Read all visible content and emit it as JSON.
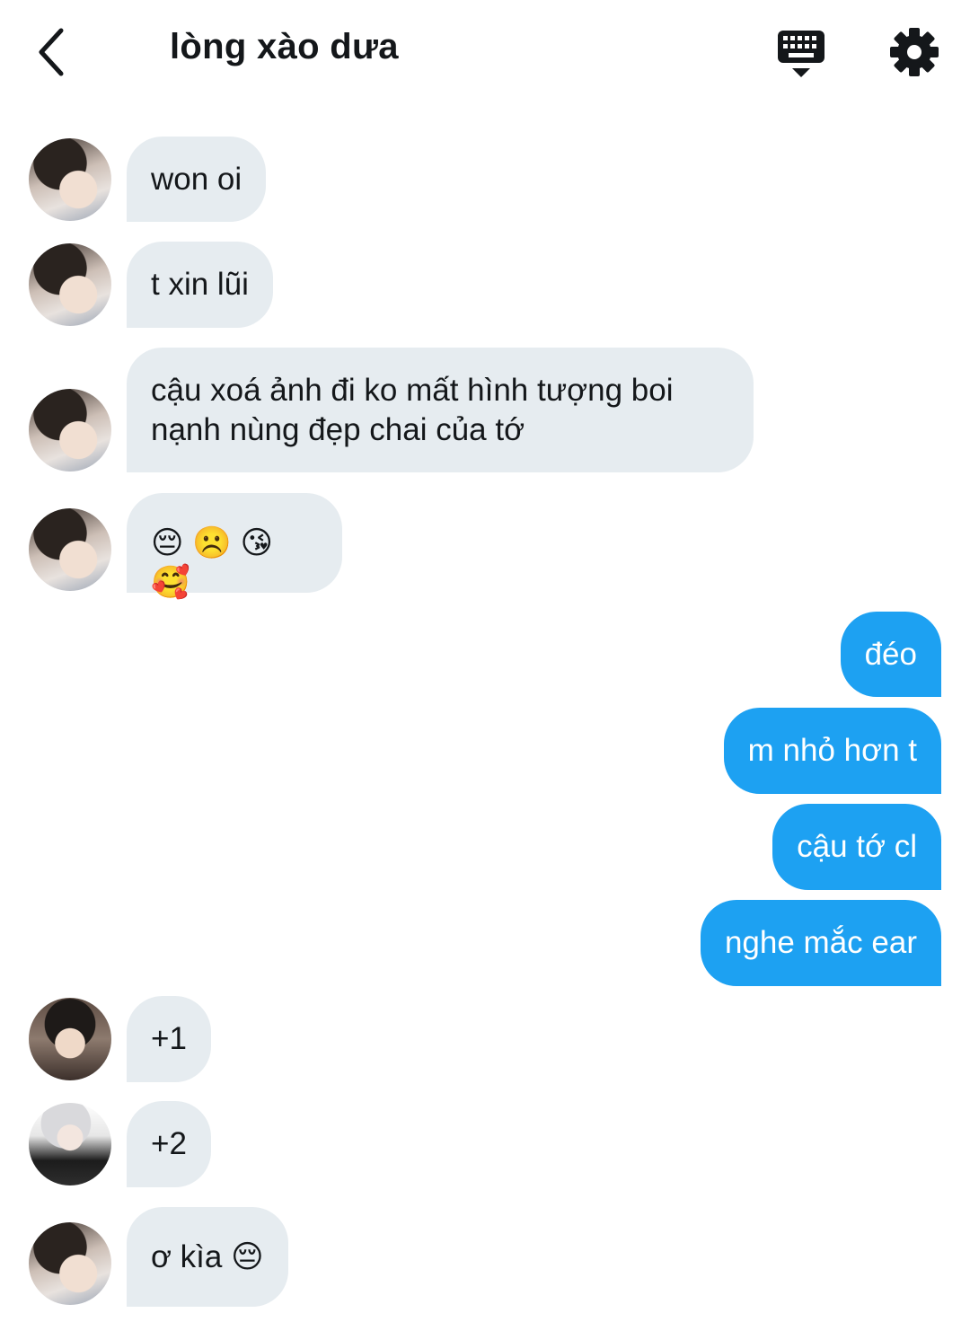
{
  "header": {
    "title": "lòng xào dưa",
    "back_icon": "chevron-left-icon",
    "keyboard_icon": "keyboard-icon",
    "settings_icon": "gear-icon"
  },
  "colors": {
    "incoming_bubble": "#e6ecf0",
    "outgoing_bubble": "#1da1f2",
    "text": "#14171a"
  },
  "messages": [
    {
      "direction": "in",
      "text": "won oi"
    },
    {
      "direction": "in",
      "text": "t xin lũi"
    },
    {
      "direction": "in",
      "text": "cậu xoá ảnh đi ko mất hình tượng boi\nnạnh nùng đẹp chai của tớ"
    },
    {
      "direction": "in",
      "text": "😔 ☹️ 😘 🥰"
    },
    {
      "direction": "out",
      "text": "đéo"
    },
    {
      "direction": "out",
      "text": "m nhỏ hơn t"
    },
    {
      "direction": "out",
      "text": "cậu tớ cl"
    },
    {
      "direction": "out",
      "text": "nghe mắc ear"
    },
    {
      "direction": "in",
      "text": "+1"
    },
    {
      "direction": "in",
      "text": "+2"
    },
    {
      "direction": "in",
      "text": "ơ kìa 😔"
    }
  ]
}
